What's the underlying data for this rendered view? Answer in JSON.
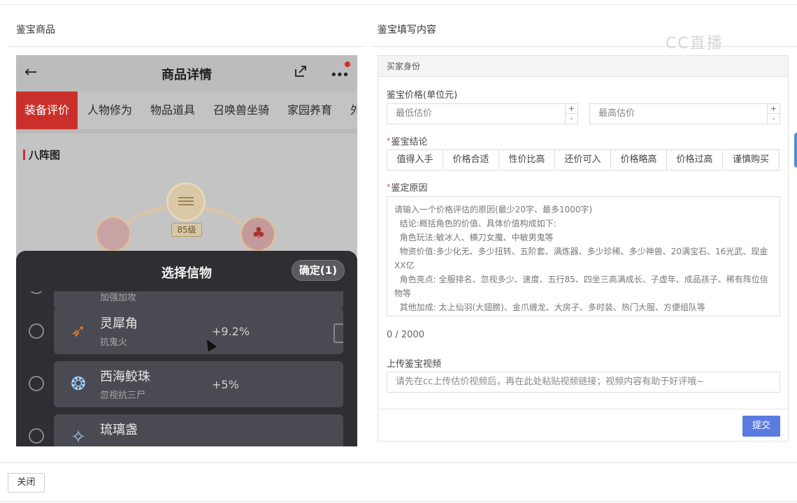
{
  "left_section_title": "鉴宝商品",
  "right_section_title": "鉴宝填写内容",
  "watermark": "CC直播",
  "phone": {
    "title": "商品详情",
    "tabs": [
      "装备评价",
      "人物修为",
      "物品道具",
      "召唤兽坐骑",
      "家园养育",
      "外"
    ],
    "section_label": "八阵图",
    "level_badge": "85级",
    "sheet": {
      "title": "选择信物",
      "confirm_label": "确定(1)",
      "items": [
        {
          "name": "",
          "effect": "加强加攻",
          "value": ""
        },
        {
          "name": "灵犀角",
          "effect": "抗鬼火",
          "value": "+9.2%"
        },
        {
          "name": "西海鲛珠",
          "effect": "忽视抗三尸",
          "value": "+5%"
        },
        {
          "name": "琉璃盏",
          "effect": "",
          "value": ""
        }
      ]
    }
  },
  "form": {
    "header": "买家身份",
    "price_label": "鉴宝价格(单位元)",
    "min_price_placeholder": "最低估价",
    "max_price_placeholder": "最高估价",
    "conclusion_label": "鉴宝结论",
    "conclusion_options": [
      "值得入手",
      "价格合适",
      "性价比高",
      "还价可入",
      "价格略高",
      "价格过高",
      "谨慎购买"
    ],
    "reason_label": "鉴定原因",
    "reason_placeholder_lines": [
      "请输入一个价格评估的原因(最少20字、最多1000字)",
      "  结论:概括角色的价值、具体价值构成如下:",
      "  角色玩法:敏冰人、横刀女魔、中敏男鬼等",
      "  物资价值:多少化无、多少扭转、五阶套、满炼器、多少珍稀、多少神兽、20满宝石、16光武、现金XX亿",
      "  角色亮点: 全服排名、忽视多少、速度、五行85、四坐三高满成长、子虚年、成品孩子、稀有阵位信物等",
      "  其他加成: 太上仙羽(大翅膀)、金爪缠龙、大房子、多时装、热门大服、方便组队等"
    ],
    "counter": "0 / 2000",
    "video_label": "上传鉴宝视频",
    "video_placeholder": "请先在cc上传估价视频后，再在此处粘贴视频链接；视频内容有助于好评哦~",
    "submit_label": "提交"
  },
  "close_label": "关闭"
}
